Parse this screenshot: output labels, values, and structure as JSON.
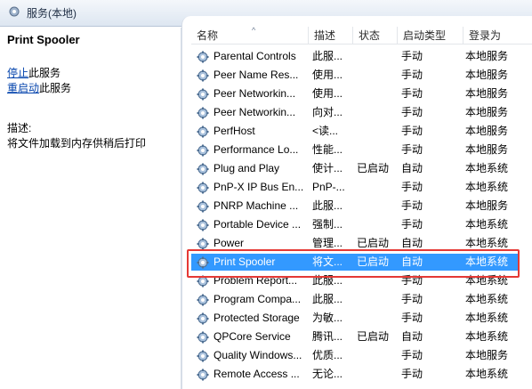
{
  "window": {
    "title": "服务(本地)"
  },
  "left_panel": {
    "service_name": "Print Spooler",
    "actions": [
      {
        "link": "停止",
        "suffix": "此服务"
      },
      {
        "link": "重启动",
        "suffix": "此服务"
      }
    ],
    "description_label": "描述:",
    "description_text": "将文件加载到内存供稍后打印"
  },
  "columns": [
    "名称",
    "描述",
    "状态",
    "启动类型",
    "登录为"
  ],
  "services": [
    {
      "name": "Parental Controls",
      "desc": "此服...",
      "status": "",
      "startup": "手动",
      "logon": "本地服务"
    },
    {
      "name": "Peer Name Res...",
      "desc": "使用...",
      "status": "",
      "startup": "手动",
      "logon": "本地服务"
    },
    {
      "name": "Peer Networkin...",
      "desc": "使用...",
      "status": "",
      "startup": "手动",
      "logon": "本地服务"
    },
    {
      "name": "Peer Networkin...",
      "desc": "向对...",
      "status": "",
      "startup": "手动",
      "logon": "本地服务"
    },
    {
      "name": "PerfHost",
      "desc": "<读...",
      "status": "",
      "startup": "手动",
      "logon": "本地服务"
    },
    {
      "name": "Performance Lo...",
      "desc": "性能...",
      "status": "",
      "startup": "手动",
      "logon": "本地服务"
    },
    {
      "name": "Plug and Play",
      "desc": "使计...",
      "status": "已启动",
      "startup": "自动",
      "logon": "本地系统"
    },
    {
      "name": "PnP-X IP Bus En...",
      "desc": "PnP-...",
      "status": "",
      "startup": "手动",
      "logon": "本地系统"
    },
    {
      "name": "PNRP Machine ...",
      "desc": "此服...",
      "status": "",
      "startup": "手动",
      "logon": "本地服务"
    },
    {
      "name": "Portable Device ...",
      "desc": "强制...",
      "status": "",
      "startup": "手动",
      "logon": "本地系统"
    },
    {
      "name": "Power",
      "desc": "管理...",
      "status": "已启动",
      "startup": "自动",
      "logon": "本地系统"
    },
    {
      "name": "Print Spooler",
      "desc": "将文...",
      "status": "已启动",
      "startup": "自动",
      "logon": "本地系统",
      "selected": true
    },
    {
      "name": "Problem Report...",
      "desc": "此服...",
      "status": "",
      "startup": "手动",
      "logon": "本地系统"
    },
    {
      "name": "Program Compa...",
      "desc": "此服...",
      "status": "",
      "startup": "手动",
      "logon": "本地系统"
    },
    {
      "name": "Protected Storage",
      "desc": "为敏...",
      "status": "",
      "startup": "手动",
      "logon": "本地系统"
    },
    {
      "name": "QPCore Service",
      "desc": "腾讯...",
      "status": "已启动",
      "startup": "自动",
      "logon": "本地系统"
    },
    {
      "name": "Quality Windows...",
      "desc": "优质...",
      "status": "",
      "startup": "手动",
      "logon": "本地服务"
    },
    {
      "name": "Remote Access ...",
      "desc": "无论...",
      "status": "",
      "startup": "手动",
      "logon": "本地系统"
    }
  ],
  "colors": {
    "selection": "#3399ff",
    "highlight_box": "#e53935",
    "link": "#0645ad"
  },
  "icons": {
    "window": "services-gear-icon",
    "row": "service-gear-icon"
  }
}
